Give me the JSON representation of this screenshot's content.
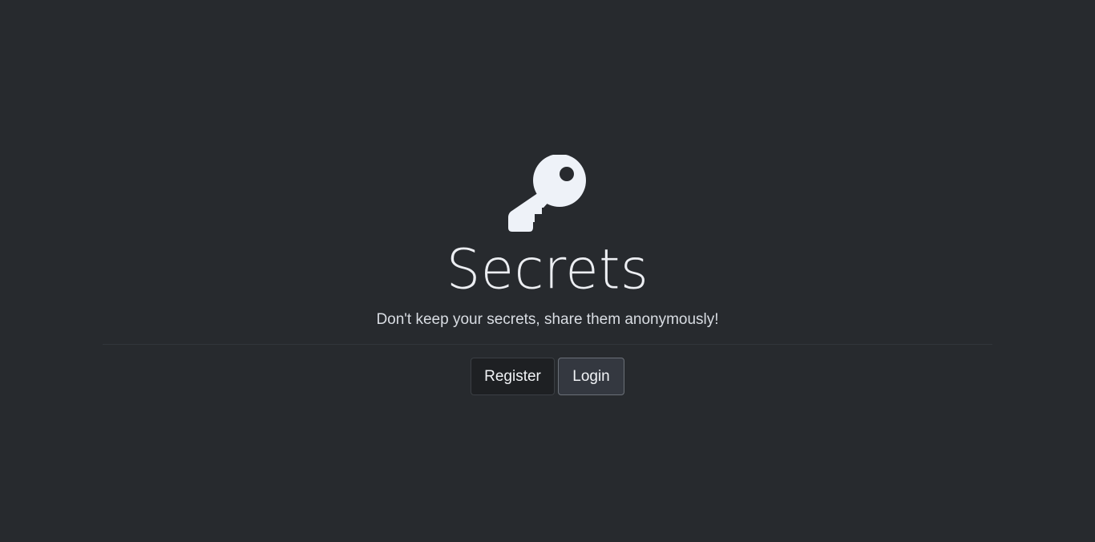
{
  "hero": {
    "icon": "key-icon",
    "title": "Secrets",
    "subtitle": "Don't keep your secrets, share them anonymously!"
  },
  "actions": {
    "register_label": "Register",
    "login_label": "Login"
  },
  "colors": {
    "background": "#272a2e",
    "text": "#eceef2",
    "register_bg": "#1e2023",
    "login_bg": "#343840"
  }
}
